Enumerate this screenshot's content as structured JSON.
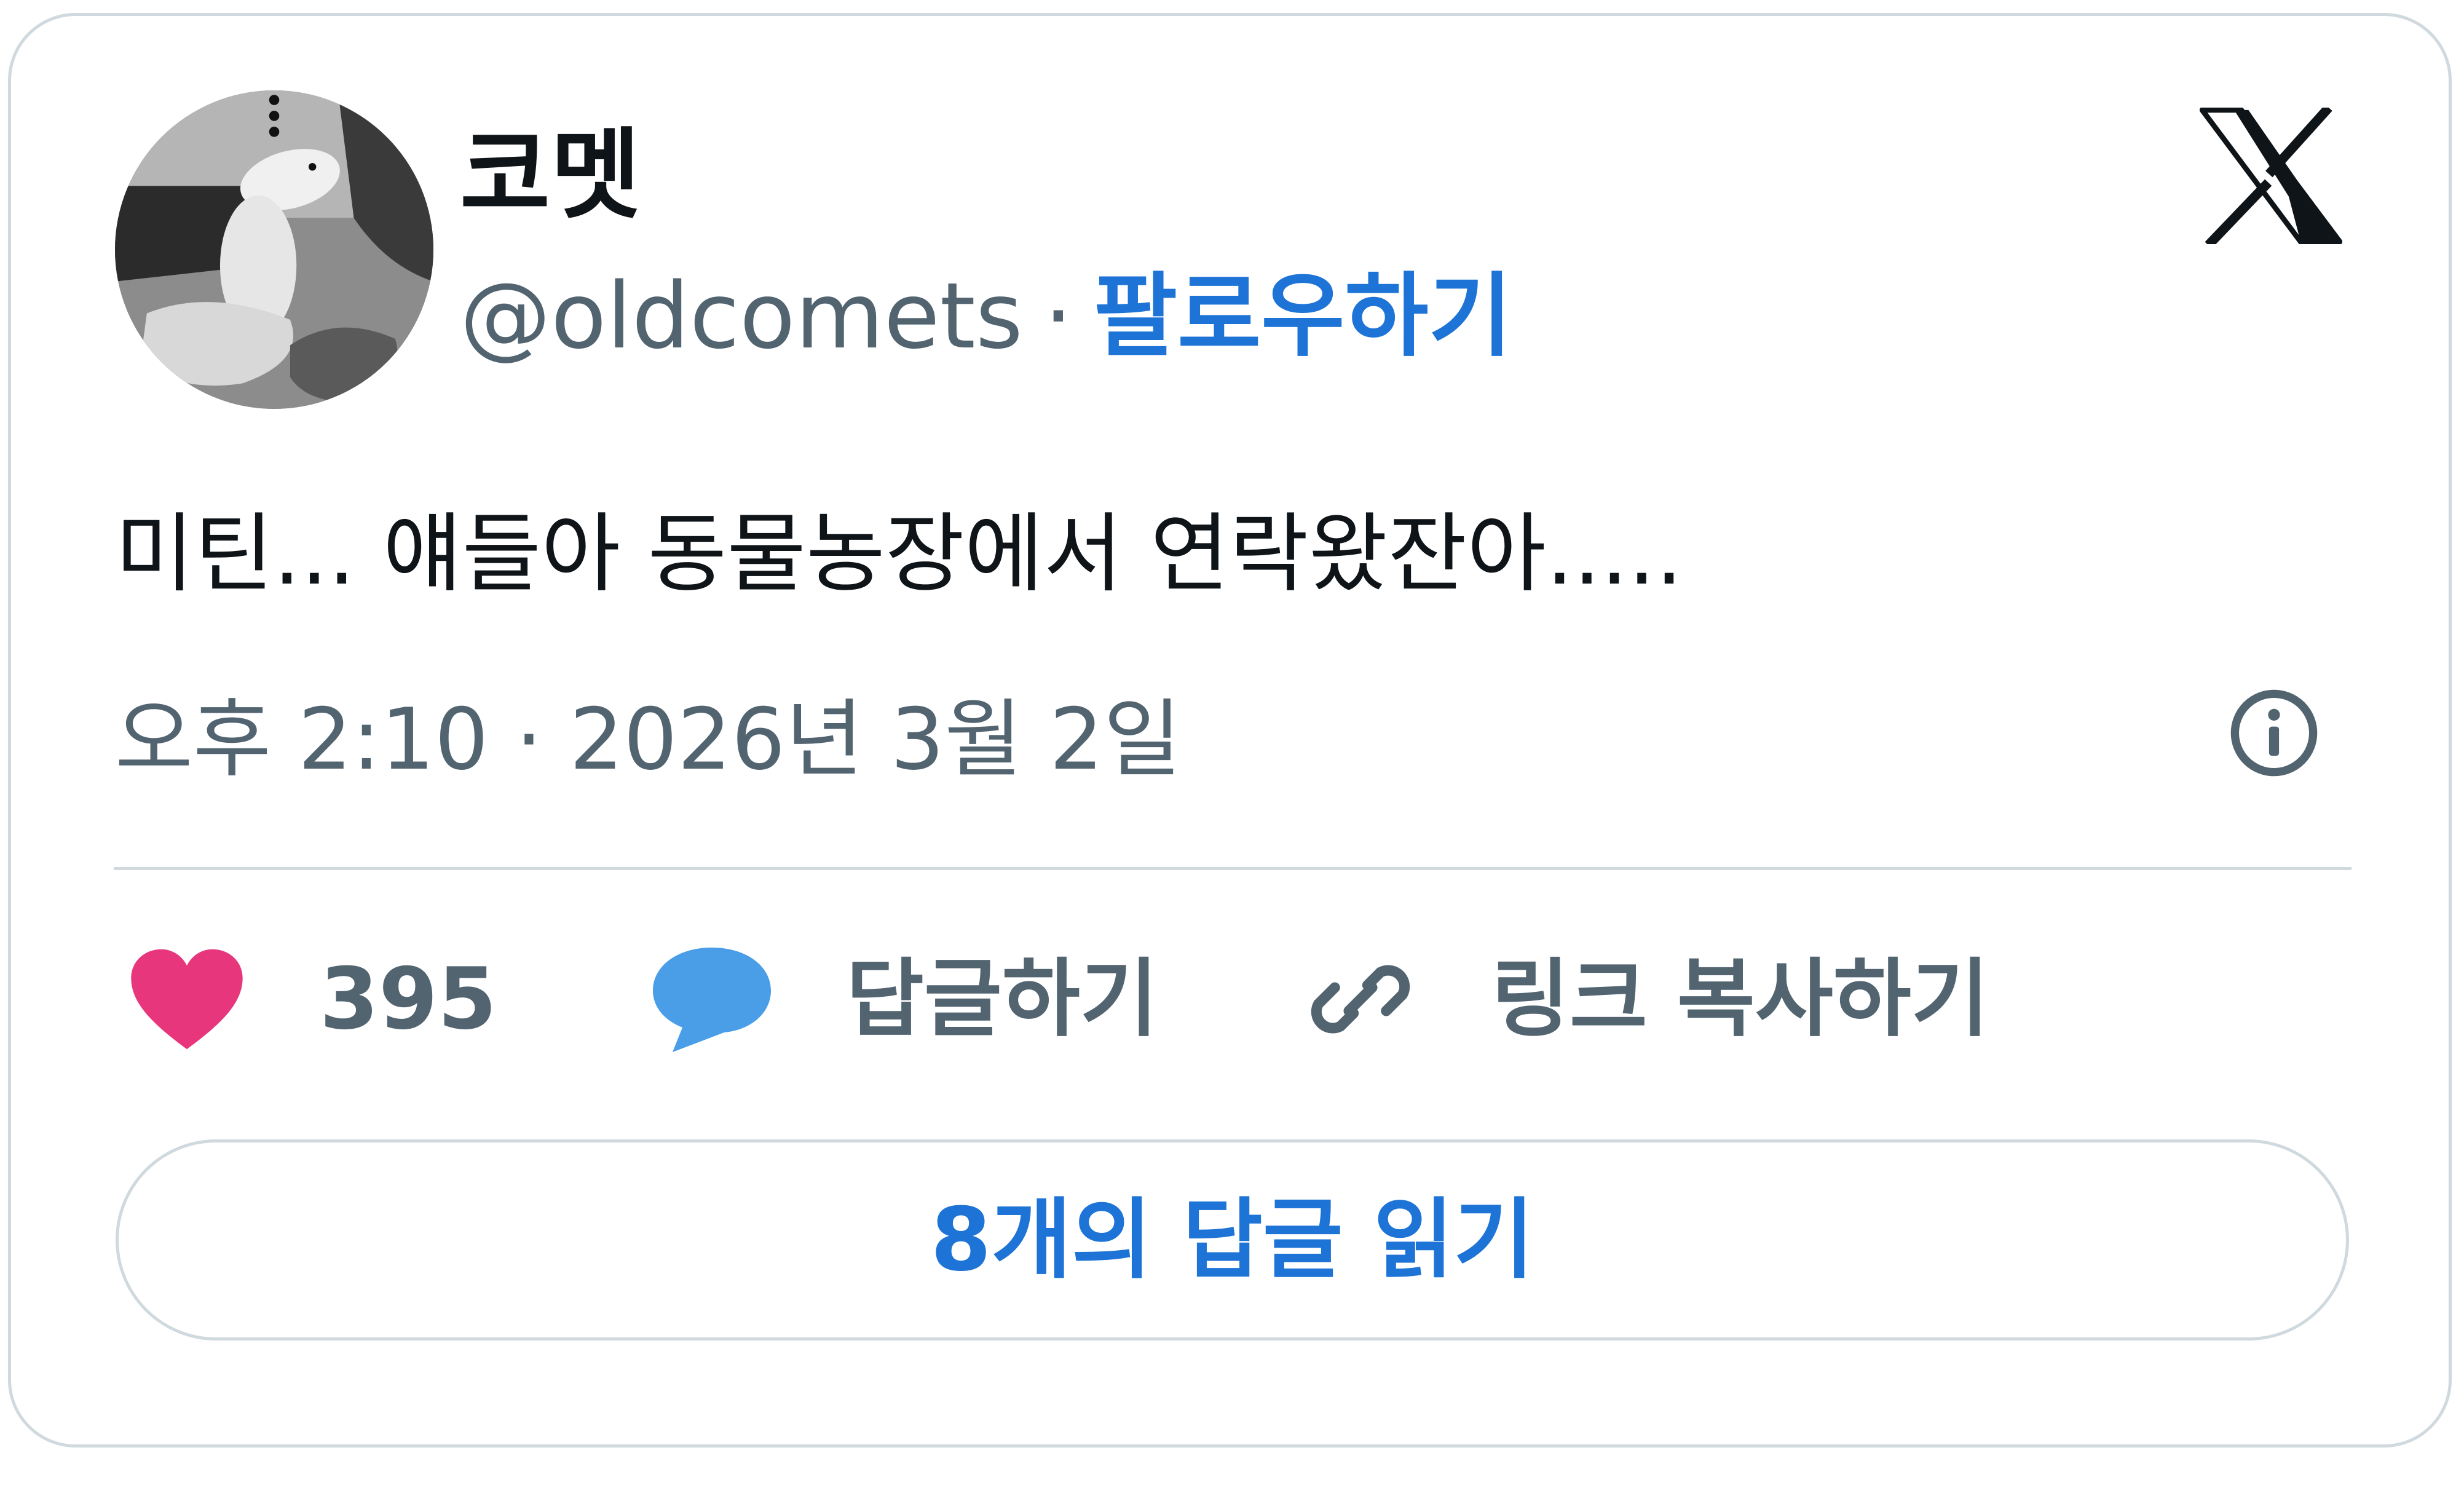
{
  "user": {
    "display_name": "코멧",
    "handle": "@oldcomets",
    "separator": "·",
    "follow_label": "팔로우하기"
  },
  "tweet": {
    "text": "미틴... 얘들아 동물농장에서 연락왔잔아.....",
    "timestamp": "오후 2:10 · 2026년 3월 2일"
  },
  "actions": {
    "like_count": "395",
    "reply_label": "답글하기",
    "copy_link_label": "링크 복사하기"
  },
  "read_replies_label": "8개의 답글 읽기",
  "colors": {
    "accent_blue": "#1d73d6",
    "heart_pink": "#e8367c",
    "bubble_blue": "#4a9ee8",
    "secondary_text": "#536471",
    "primary_text": "#0f1419",
    "border": "#cfd9de"
  },
  "icons": {
    "brand": "x-logo-icon",
    "info": "info-icon",
    "like": "heart-icon",
    "reply": "speech-bubble-icon",
    "copy": "link-icon"
  }
}
